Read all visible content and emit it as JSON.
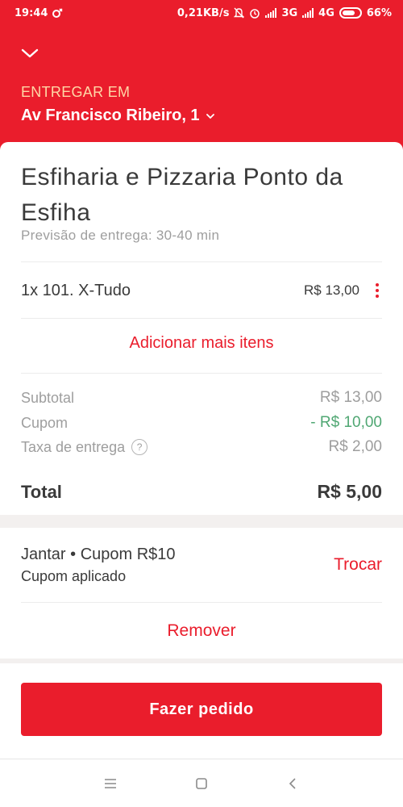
{
  "status_bar": {
    "time": "19:44",
    "network_speed": "0,21KB/s",
    "network_1": "3G",
    "network_2": "4G",
    "battery": "66%",
    "icons": [
      "data-saver-icon",
      "mute-icon",
      "alarm-icon",
      "signal-icon",
      "battery-icon"
    ]
  },
  "header": {
    "background_color": "#ea1d2c",
    "deliver_label": "ENTREGAR EM",
    "address": "Av Francisco Ribeiro, 1"
  },
  "restaurant": {
    "name": "Esfiharia e Pizzaria Ponto da Esfiha",
    "eta": "Previsão de entrega: 30-40 min"
  },
  "items": [
    {
      "label": "1x 101. X-Tudo",
      "price": "R$ 13,00"
    }
  ],
  "add_more_label": "Adicionar mais itens",
  "summary": {
    "subtotal_label": "Subtotal",
    "subtotal_value": "R$ 13,00",
    "coupon_label": "Cupom",
    "coupon_value": "- R$ 10,00",
    "delivery_fee_label": "Taxa de entrega",
    "delivery_fee_help": "?",
    "delivery_fee_value": "R$ 2,00",
    "total_label": "Total",
    "total_value": "R$ 5,00"
  },
  "coupon": {
    "title": "Jantar • Cupom R$10",
    "status": "Cupom aplicado",
    "swap_label": "Trocar",
    "remove_label": "Remover",
    "discount_color": "#50a773"
  },
  "order_button_label": "Fazer pedido",
  "nav_bar": {
    "icons": [
      "menu-icon",
      "home-icon",
      "back-icon"
    ]
  }
}
